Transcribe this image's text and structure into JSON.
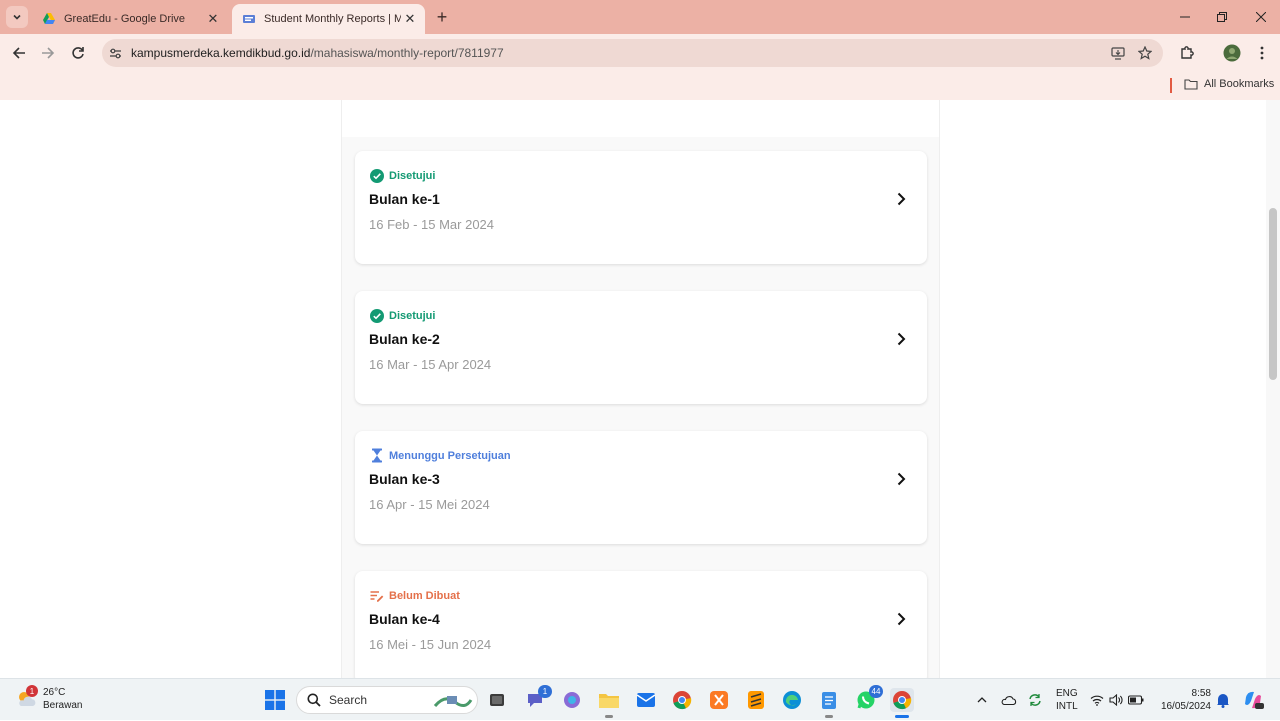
{
  "browser": {
    "tabs": [
      {
        "title": "GreatEdu - Google Drive",
        "active": false
      },
      {
        "title": "Student Monthly Reports | Merdeka",
        "active": true
      }
    ],
    "url": {
      "host": "kampusmerdeka.kemdikbud.go.id",
      "path": "/mahasiswa/monthly-report/7811977"
    },
    "bookmarks_label": "All Bookmarks"
  },
  "reports": [
    {
      "status": "Disetujui",
      "status_type": "approved",
      "month": "Bulan ke-1",
      "range": "16 Feb - 15 Mar 2024"
    },
    {
      "status": "Disetujui",
      "status_type": "approved",
      "month": "Bulan ke-2",
      "range": "16 Mar - 15 Apr 2024"
    },
    {
      "status": "Menunggu Persetujuan",
      "status_type": "waiting",
      "month": "Bulan ke-3",
      "range": "16 Apr - 15 Mei 2024"
    },
    {
      "status": "Belum Dibuat",
      "status_type": "draft",
      "month": "Bulan ke-4",
      "range": "16 Mei - 15 Jun 2024"
    }
  ],
  "colors": {
    "approved": "#139a73",
    "waiting": "#4f7fdc",
    "draft": "#e4704a",
    "tabbar": "#ecb1a5"
  },
  "taskbar": {
    "weather": {
      "temp": "26°C",
      "desc": "Berawan",
      "badge": "1"
    },
    "search_label": "Search",
    "teams_badge": "1",
    "whatsapp_badge": "44",
    "lang_line1": "ENG",
    "lang_line2": "INTL",
    "time": "8:58",
    "date": "16/05/2024"
  }
}
